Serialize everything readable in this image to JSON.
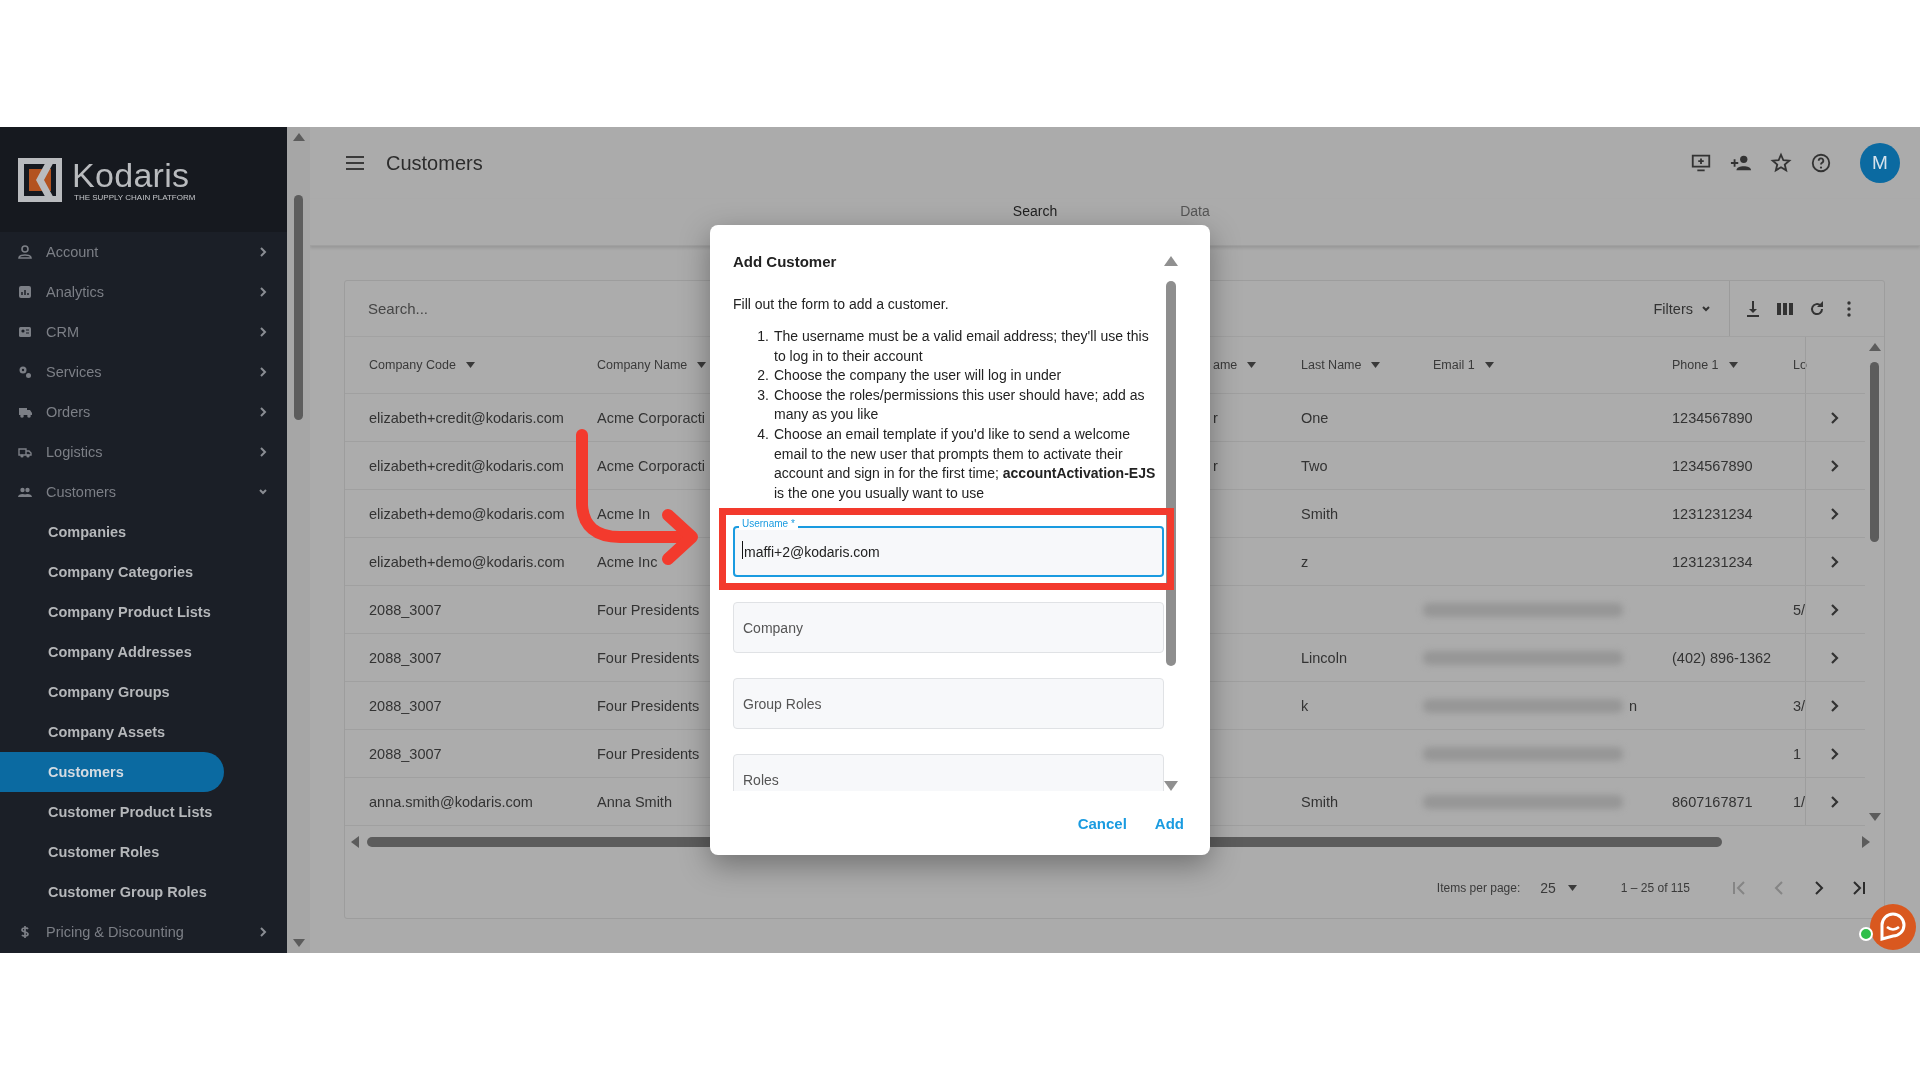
{
  "sidebar": {
    "logo": {
      "name": "Kodaris",
      "tagline": "THE SUPPLY CHAIN PLATFORM"
    },
    "items": [
      {
        "label": "Account",
        "expanded": false
      },
      {
        "label": "Analytics",
        "expanded": false
      },
      {
        "label": "CRM",
        "expanded": false
      },
      {
        "label": "Services",
        "expanded": false
      },
      {
        "label": "Orders",
        "expanded": false
      },
      {
        "label": "Logistics",
        "expanded": false
      },
      {
        "label": "Customers",
        "expanded": true,
        "children": [
          {
            "label": "Companies",
            "selected": false
          },
          {
            "label": "Company Categories",
            "selected": false
          },
          {
            "label": "Company Product Lists",
            "selected": false
          },
          {
            "label": "Company Addresses",
            "selected": false
          },
          {
            "label": "Company Groups",
            "selected": false
          },
          {
            "label": "Company Assets",
            "selected": false
          },
          {
            "label": "Customers",
            "selected": true
          },
          {
            "label": "Customer Product Lists",
            "selected": false
          },
          {
            "label": "Customer Roles",
            "selected": false
          },
          {
            "label": "Customer Group Roles",
            "selected": false
          }
        ]
      },
      {
        "label": "Pricing & Discounting",
        "expanded": false
      }
    ]
  },
  "header": {
    "title": "Customers",
    "avatar": "M"
  },
  "tabs": [
    {
      "label": "Search",
      "selected": true
    },
    {
      "label": "Data",
      "selected": false
    }
  ],
  "table": {
    "search": {
      "placeholder": "Search..."
    },
    "filters": "Filters",
    "columns": [
      {
        "label": "Company Code",
        "sortable": true
      },
      {
        "label": "Company Name",
        "sortable": true
      },
      {
        "label": "ame",
        "sortable": true
      },
      {
        "label": "Last Name",
        "sortable": true
      },
      {
        "label": "Email 1",
        "sortable": true
      },
      {
        "label": "Phone 1",
        "sortable": true
      },
      {
        "label": "Lo",
        "sortable": false
      }
    ],
    "rows": [
      {
        "company_code": "elizabeth+credit@kodaris.com",
        "company_name": "Acme Corporacti",
        "column_3": "r",
        "last_name": "One",
        "email_1_redacted": false,
        "phone_1": "1234567890"
      },
      {
        "company_code": "elizabeth+credit@kodaris.com",
        "company_name": "Acme Corporacti",
        "column_3": "r",
        "last_name": "Two",
        "email_1_redacted": false,
        "phone_1": "1234567890"
      },
      {
        "company_code": "elizabeth+demo@kodaris.com",
        "company_name": "Acme In",
        "last_name": "Smith",
        "email_1_redacted": false,
        "phone_1": "1231231234"
      },
      {
        "company_code": "elizabeth+demo@kodaris.com",
        "company_name": "Acme Inc",
        "last_name": "z",
        "email_1_redacted": false,
        "phone_1": "1231231234"
      },
      {
        "company_code": "2088_3007",
        "company_name": "Four Presidents",
        "email_1_redacted": true,
        "column_7": "5/"
      },
      {
        "company_code": "2088_3007",
        "company_name": "Four Presidents",
        "last_name": "Lincoln",
        "email_1_redacted": true,
        "phone_1": "(402) 896-1362"
      },
      {
        "company_code": "2088_3007",
        "company_name": "Four Presidents",
        "last_name": "k",
        "email_1_redacted": true,
        "email_1_tail": "n",
        "column_7": "3/"
      },
      {
        "company_code": "2088_3007",
        "company_name": "Four Presidents",
        "email_1_redacted": true,
        "column_7": "1"
      },
      {
        "company_code": "anna.smith@kodaris.com",
        "company_name": "Anna Smith",
        "last_name": "Smith",
        "email_1_redacted": true,
        "phone_1": "8607167871",
        "column_7": "1/"
      }
    ],
    "pagination": {
      "items_per_page_label": "Items per page:",
      "page_size": "25",
      "range": "1 – 25 of 115",
      "buttons": [
        {
          "disabled": true
        },
        {
          "disabled": true
        },
        {
          "disabled": false
        },
        {
          "disabled": false
        }
      ]
    }
  },
  "dialog": {
    "title": "Add Customer",
    "intro": "Fill out the form to add a customer.",
    "steps": [
      {
        "number": "1.",
        "text": "The username must be a valid email address; they'll use this to log in to their account"
      },
      {
        "number": "2.",
        "text": "Choose the company the user will log in under"
      },
      {
        "number": "3.",
        "text": "Choose the roles/permissions this user should have; add as many as you like"
      },
      {
        "number": "4.",
        "text": "Choose an email template if you'd like to send a welcome email to the new user that prompts them to activate their account and sign in for the first time; **accountActivation-EJS** is the one you usually want to use"
      }
    ],
    "fields": [
      {
        "label": "Username *",
        "value": "maffi+2@kodaris.com",
        "focused": true
      },
      {
        "placeholder": "Company",
        "focused": false
      },
      {
        "placeholder": "Group Roles",
        "focused": false
      },
      {
        "placeholder": "Roles",
        "focused": false
      }
    ],
    "buttons": [
      "Cancel",
      "Add"
    ]
  }
}
